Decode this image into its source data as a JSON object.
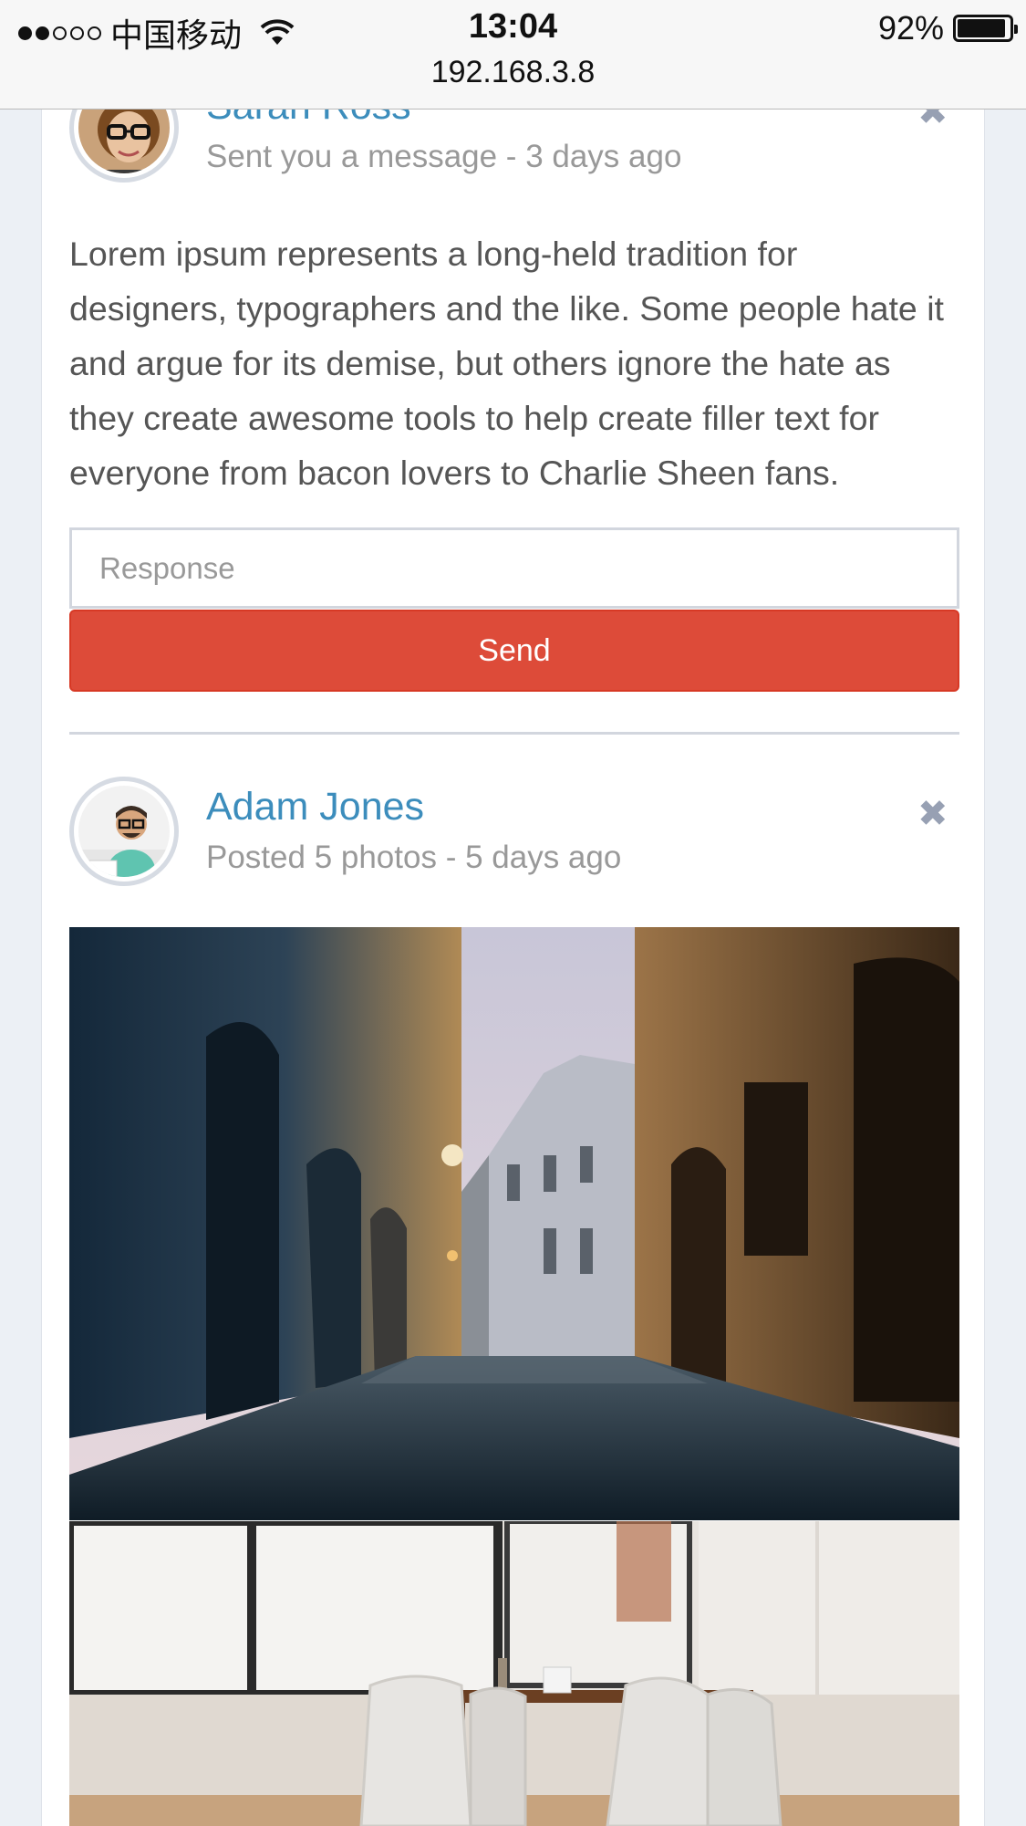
{
  "status_bar": {
    "carrier": "中国移动",
    "time": "13:04",
    "battery": "92%",
    "battery_level": 0.92,
    "url": "192.168.3.8"
  },
  "posts": [
    {
      "user": "Sarah Ross",
      "meta": "Sent you a message - 3 days ago",
      "body": "Lorem ipsum represents a long-held tradition for designers, typographers and the like. Some people hate it and argue for its demise, but others ignore the hate as they create awesome tools to help create filler text for everyone from bacon lovers to Charlie Sheen fans.",
      "response_placeholder": "Response",
      "send_label": "Send"
    },
    {
      "user": "Adam Jones",
      "meta": "Posted 5 photos - 5 days ago"
    }
  ],
  "colors": {
    "link": "#3c8dbc",
    "danger": "#dd4b39",
    "background": "#ecf0f5"
  },
  "icons": {
    "close": "close-icon",
    "wifi": "wifi-icon",
    "battery": "battery-icon"
  }
}
